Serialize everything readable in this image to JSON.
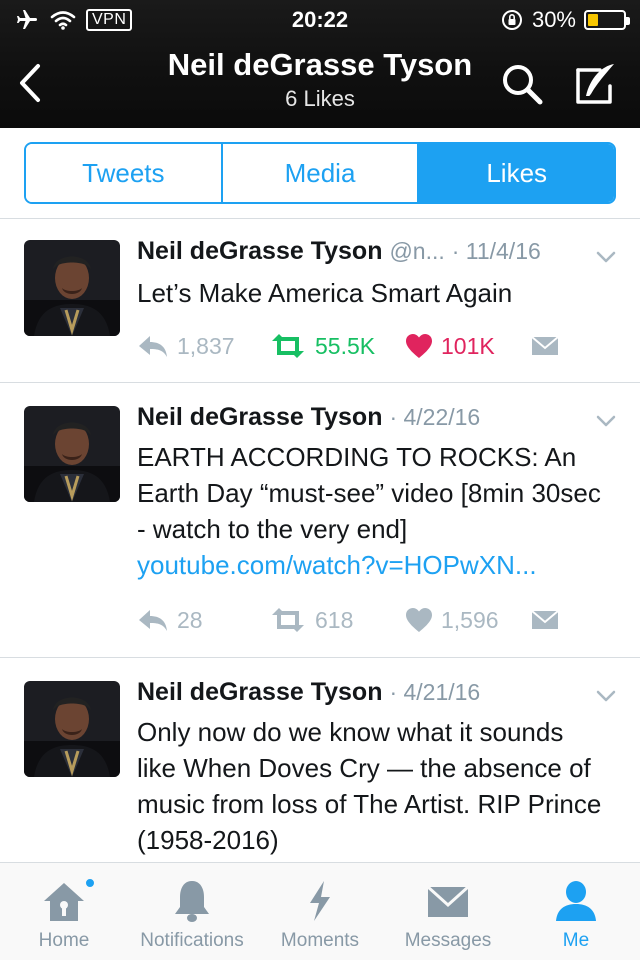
{
  "status": {
    "vpn": "VPN",
    "time": "20:22",
    "battery": "30%",
    "battery_level": 0.3
  },
  "nav": {
    "title": "Neil deGrasse Tyson",
    "subtitle": "6 Likes"
  },
  "tabs": [
    {
      "label": "Tweets",
      "active": false
    },
    {
      "label": "Media",
      "active": false
    },
    {
      "label": "Likes",
      "active": true
    }
  ],
  "tweets": [
    {
      "name": "Neil deGrasse Tyson",
      "handle": "@n...",
      "date": "· 11/4/16",
      "text": "Let’s Make America Smart Again",
      "link": "",
      "replies": "1,837",
      "retweets": "55.5K",
      "likes": "101K",
      "retweeted": true,
      "liked": true
    },
    {
      "name": "Neil deGrasse Tyson",
      "handle": "",
      "date": "· 4/22/16",
      "text": "EARTH ACCORDING TO ROCKS:  An Earth Day “must-see” video [8min 30sec - watch to the very end]",
      "link": "youtube.com/watch?v=HOPwXN...",
      "replies": "28",
      "retweets": "618",
      "likes": "1,596",
      "retweeted": false,
      "liked": false
    },
    {
      "name": "Neil deGrasse Tyson",
      "handle": "",
      "date": "· 4/21/16",
      "text": "Only now do we know what it sounds like When Doves Cry — the absence of music from loss of The Artist. RIP Prince (1958-2016)",
      "link": "",
      "replies": "",
      "retweets": "",
      "likes": "",
      "retweeted": false,
      "liked": false
    }
  ],
  "tabbar": [
    {
      "label": "Home",
      "icon": "home-icon",
      "badge": true,
      "active": false
    },
    {
      "label": "Notifications",
      "icon": "bell-icon",
      "badge": false,
      "active": false
    },
    {
      "label": "Moments",
      "icon": "lightning-icon",
      "badge": false,
      "active": false
    },
    {
      "label": "Messages",
      "icon": "envelope-icon",
      "badge": false,
      "active": false
    },
    {
      "label": "Me",
      "icon": "person-icon",
      "badge": false,
      "active": true
    }
  ],
  "colors": {
    "accent": "#1da1f2",
    "retweet": "#17bf63",
    "like": "#e0245e",
    "muted": "#aab8c2",
    "battery": "#f7c600"
  }
}
